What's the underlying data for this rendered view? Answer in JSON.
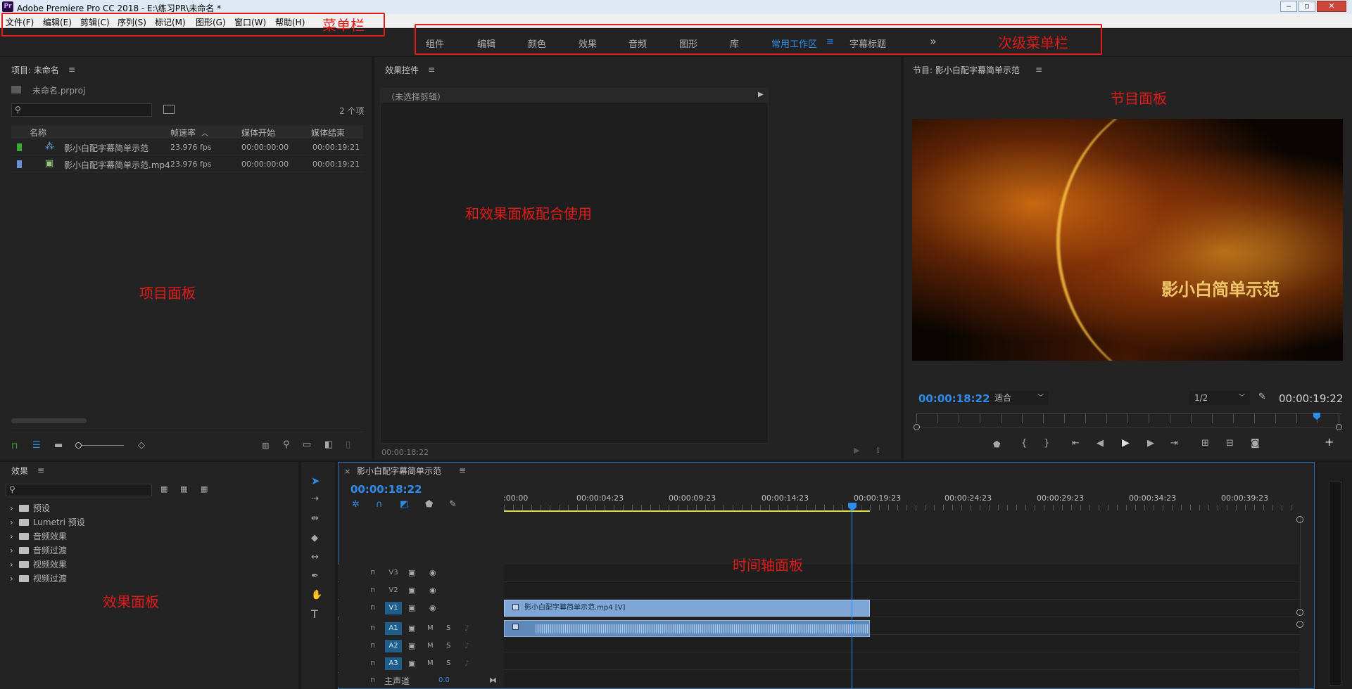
{
  "window": {
    "title": "Adobe Premiere Pro CC 2018 - E:\\练习PR\\未命名 *",
    "logo": "Pr",
    "minimize": "‒",
    "maximize": "▫",
    "close": "✕"
  },
  "menu": [
    "文件(F)",
    "编辑(E)",
    "剪辑(C)",
    "序列(S)",
    "标记(M)",
    "图形(G)",
    "窗口(W)",
    "帮助(H)"
  ],
  "workspaces": {
    "items": [
      "组件",
      "编辑",
      "颜色",
      "效果",
      "音频",
      "图形",
      "库",
      "常用工作区",
      "字幕标题"
    ],
    "active_index": 7,
    "more": "»",
    "active_menu": "≡"
  },
  "annotations": {
    "menubar": "菜单栏",
    "workspace_bar": "次级菜单栏",
    "program_panel": "节目面板",
    "effect_controls": "和效果面板配合使用",
    "project_panel": "项目面板",
    "timeline_panel": "时间轴面板",
    "effects_panel": "效果面板"
  },
  "project_panel": {
    "title": "项目: 未命名",
    "file": "未命名.prproj",
    "count": "2 个项",
    "columns": [
      "名称",
      "帧速率",
      "媒体开始",
      "媒体结束"
    ],
    "items": [
      {
        "name": "影小白配字幕简单示范",
        "fps": "23.976 fps",
        "start": "00:00:00:00",
        "end": "00:00:19:21",
        "color": "#3aaa35"
      },
      {
        "name": "影小白配字幕简单示范.mp4",
        "fps": "23.976 fps",
        "start": "00:00:00:00",
        "end": "00:00:19:21",
        "color": "#6d8fd4"
      }
    ]
  },
  "effect_controls": {
    "title": "效果控件",
    "no_clip": "（未选择剪辑）",
    "timecode": "00:00:18:22"
  },
  "program_monitor": {
    "title": "节目: 影小白配字幕简单示范",
    "overlay_text": "影小白简单示范",
    "current_tc": "00:00:18:22",
    "zoom": "适合",
    "resolution": "1/2",
    "duration_tc": "00:00:19:22"
  },
  "effects_panel": {
    "title": "效果",
    "tree": [
      "预设",
      "Lumetri 预设",
      "音频效果",
      "音频过渡",
      "视频效果",
      "视频过渡"
    ]
  },
  "timeline": {
    "sequence": "影小白配字幕简单示范",
    "timecode": "00:00:18:22",
    "ruler": [
      ":00:00",
      "00:00:04:23",
      "00:00:09:23",
      "00:00:14:23",
      "00:00:19:23",
      "00:00:24:23",
      "00:00:29:23",
      "00:00:34:23",
      "00:00:39:23"
    ],
    "video_tracks": [
      "V3",
      "V2",
      "V1"
    ],
    "audio_tracks": [
      "A1",
      "A2",
      "A3"
    ],
    "master": "主声道",
    "master_level": "0.0",
    "clip_label": "影小白配字幕简单示范.mp4 [V]",
    "track_m": "M",
    "track_s": "S",
    "close": "×"
  }
}
